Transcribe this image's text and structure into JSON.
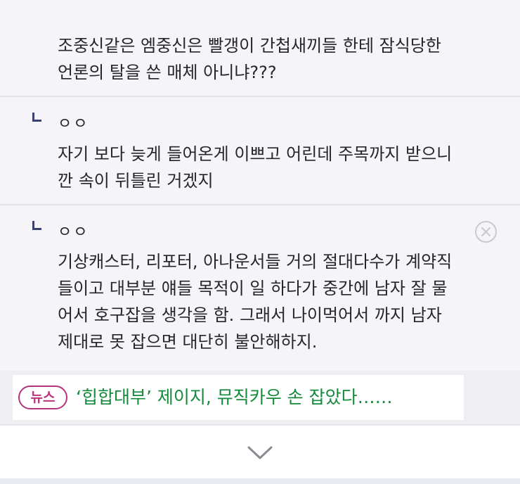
{
  "comments": [
    {
      "nickname": "",
      "text": "조중신같은 엠중신은 빨갱이 간첩새끼들 한테 잠식당한\n언론의 탈을 쓴 매체 아니냐???"
    },
    {
      "nickname": "ㅇㅇ",
      "text": "자기 보다 늦게 들어온게 이쁘고 어린데 주목까지 받으니\n깐 속이 뒤틀린 거겠지"
    },
    {
      "nickname": "ㅇㅇ",
      "text": "기상캐스터, 리포터, 아나운서들 거의 절대다수가 계약직\n들이고 대부분 얘들 목적이 일 하다가 중간에 남자 잘 물\n어서 호구잡을 생각을 함. 그래서 나이먹어서 까지 남자\n제대로 못 잡으면 대단히 불안해하지."
    }
  ],
  "news": {
    "badge": "뉴스",
    "headline": "‘힙합대부’ 제이지, 뮤직카우 손 잡았다……"
  },
  "icons": {
    "reply": "reply-arrow-icon",
    "close": "close-circle-icon",
    "more": "chevron-down-icon"
  },
  "colors": {
    "background": "#f5f5f9",
    "news_badge": "#b8337a",
    "news_headline": "#168a3c",
    "reply_mark": "#3a4070"
  }
}
